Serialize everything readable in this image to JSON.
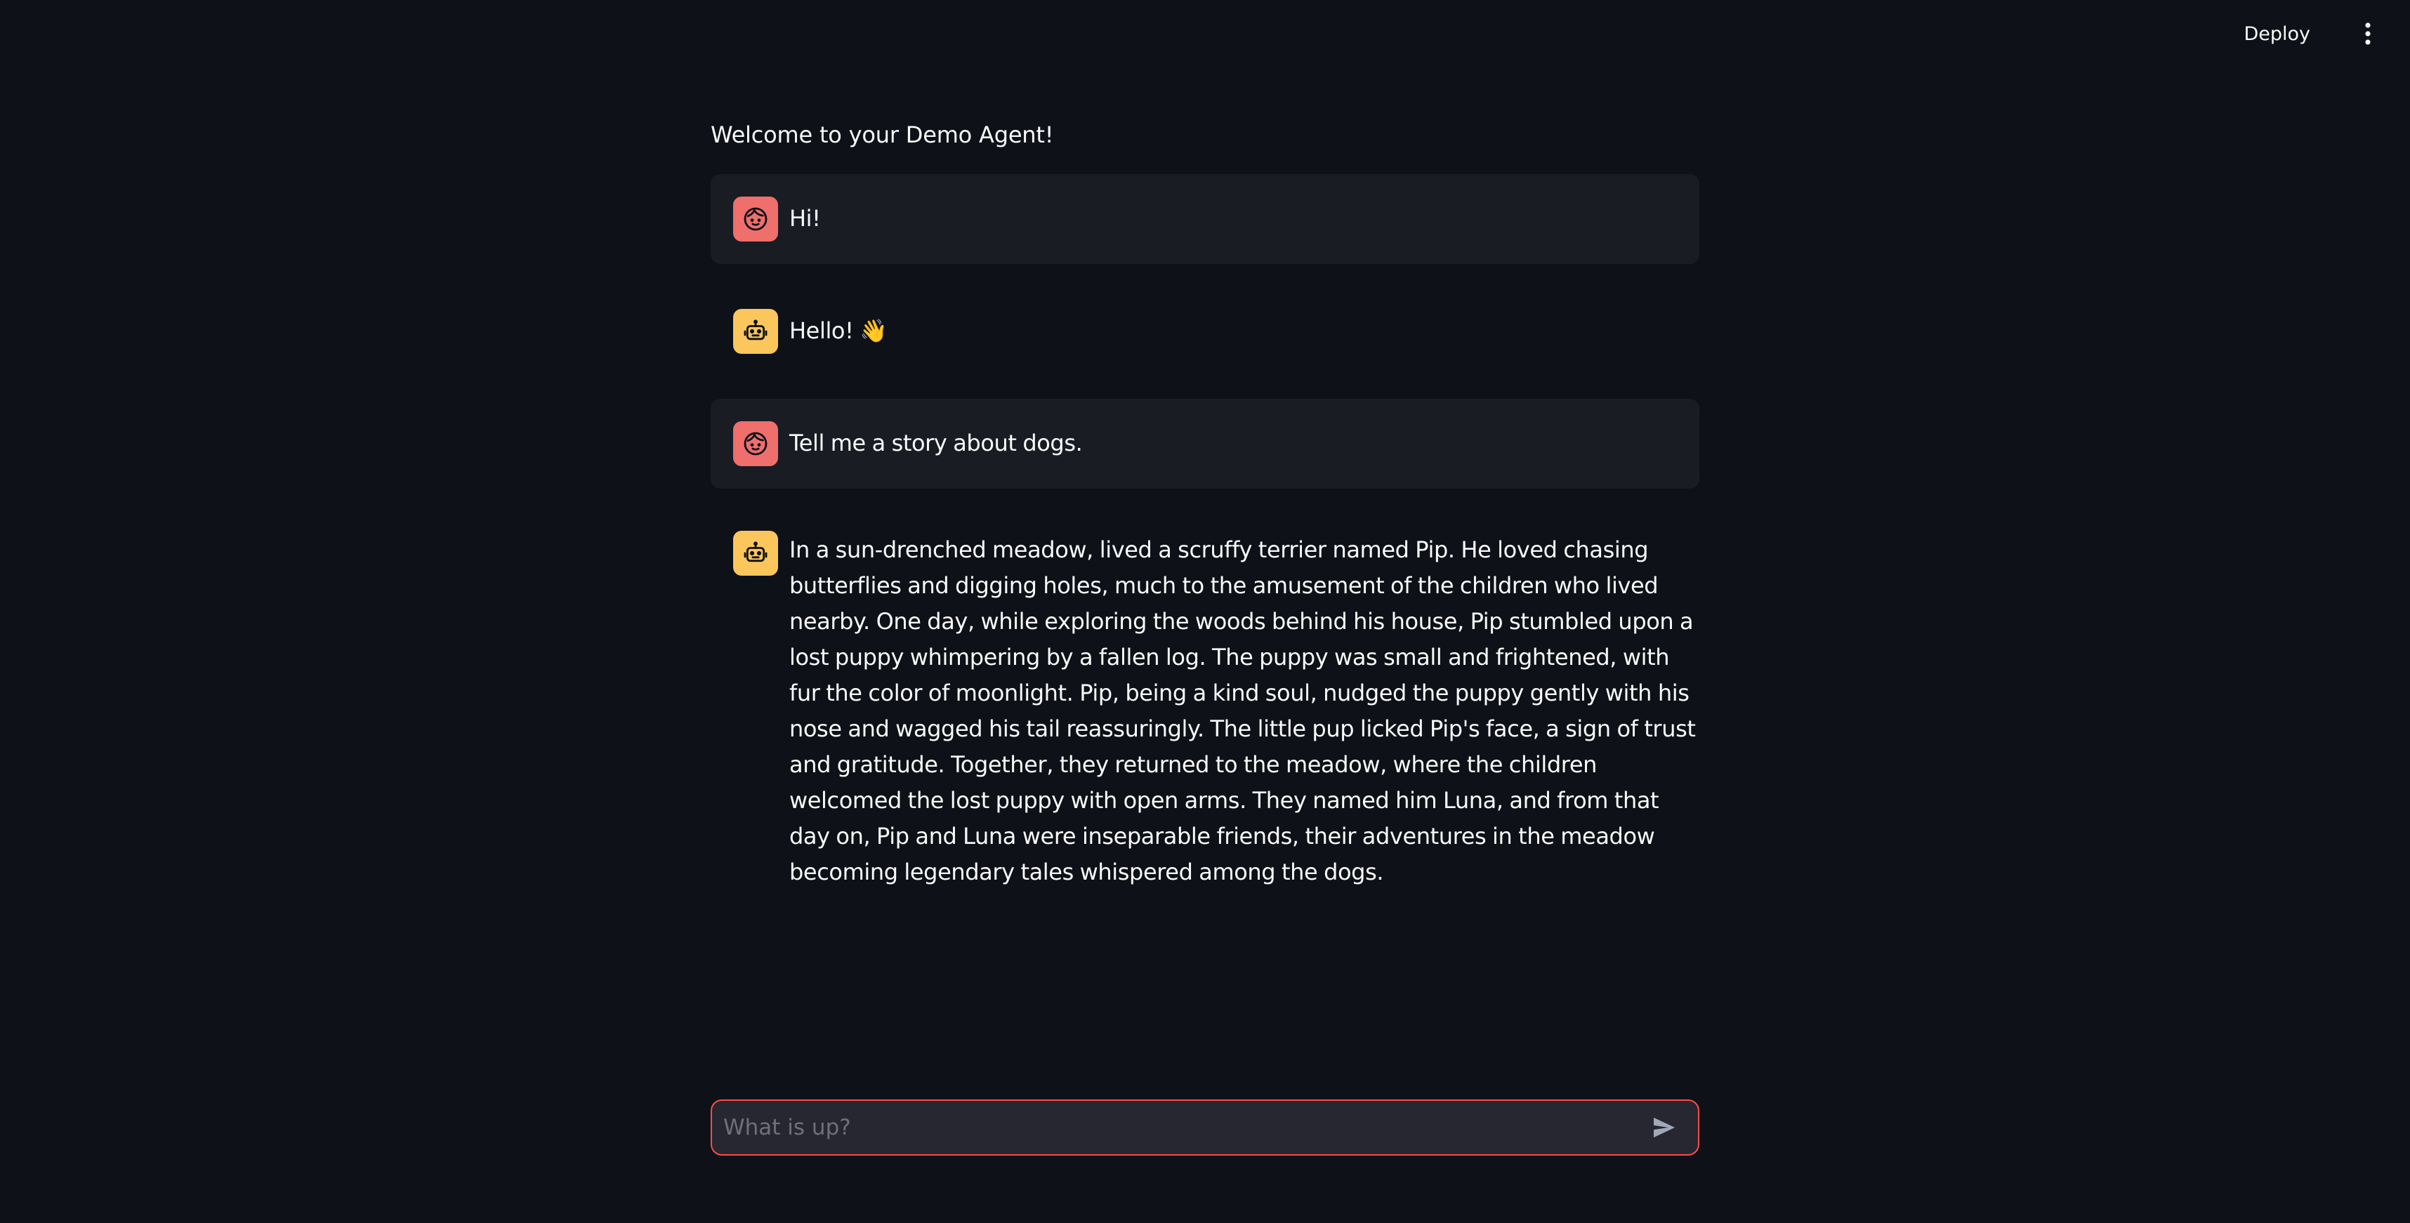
{
  "header": {
    "deploy_label": "Deploy",
    "menu_icon": "vertical-ellipsis-icon"
  },
  "main": {
    "welcome_text": "Welcome to your Demo Agent!",
    "messages": [
      {
        "role": "user",
        "avatar_icon": "user-face-icon",
        "text": "Hi!"
      },
      {
        "role": "assistant",
        "avatar_icon": "robot-icon",
        "text": "Hello! 👋"
      },
      {
        "role": "user",
        "avatar_icon": "user-face-icon",
        "text": "Tell me a story about dogs."
      },
      {
        "role": "assistant",
        "avatar_icon": "robot-icon",
        "text": "In a sun-drenched meadow, lived a scruffy terrier named Pip. He loved chasing butterflies and digging holes, much to the amusement of the children who lived nearby. One day, while exploring the woods behind his house, Pip stumbled upon a lost puppy whimpering by a fallen log. The puppy was small and frightened, with fur the color of moonlight. Pip, being a kind soul, nudged the puppy gently with his nose and wagged his tail reassuringly. The little pup licked Pip's face, a sign of trust and gratitude. Together, they returned to the meadow, where the children welcomed the lost puppy with open arms. They named him Luna, and from that day on, Pip and Luna were inseparable friends, their adventures in the meadow becoming legendary tales whispered among the dogs."
      }
    ]
  },
  "chat_input": {
    "placeholder": "What is up?",
    "value": "",
    "send_icon": "send-icon"
  },
  "colors": {
    "background": "#0e1117",
    "user_bubble": "#1a1c24",
    "user_avatar": "#ef6f6c",
    "assistant_avatar": "#fbc65b",
    "input_border": "#ff4b4b",
    "input_background": "#262730"
  }
}
